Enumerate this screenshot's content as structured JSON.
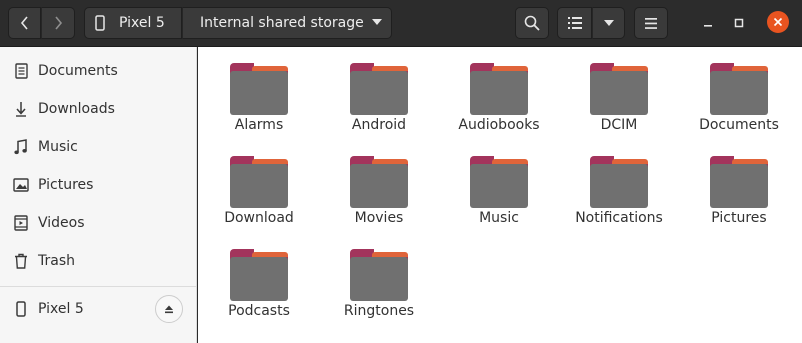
{
  "headerbar": {
    "device": "Pixel 5",
    "current_location": "Internal shared storage"
  },
  "sidebar": {
    "items": [
      {
        "label": "Documents",
        "icon": "document-icon"
      },
      {
        "label": "Downloads",
        "icon": "download-icon"
      },
      {
        "label": "Music",
        "icon": "music-icon"
      },
      {
        "label": "Pictures",
        "icon": "picture-icon"
      },
      {
        "label": "Videos",
        "icon": "video-icon"
      },
      {
        "label": "Trash",
        "icon": "trash-icon"
      }
    ],
    "device": {
      "label": "Pixel 5",
      "icon": "phone-icon"
    }
  },
  "folders": [
    "Alarms",
    "Android",
    "Audiobooks",
    "DCIM",
    "Documents",
    "Download",
    "Movies",
    "Music",
    "Notifications",
    "Pictures",
    "Podcasts",
    "Ringtones"
  ],
  "colors": {
    "accent": "#e95420",
    "folder_tab": "#a3345c",
    "folder_body": "#707070"
  }
}
